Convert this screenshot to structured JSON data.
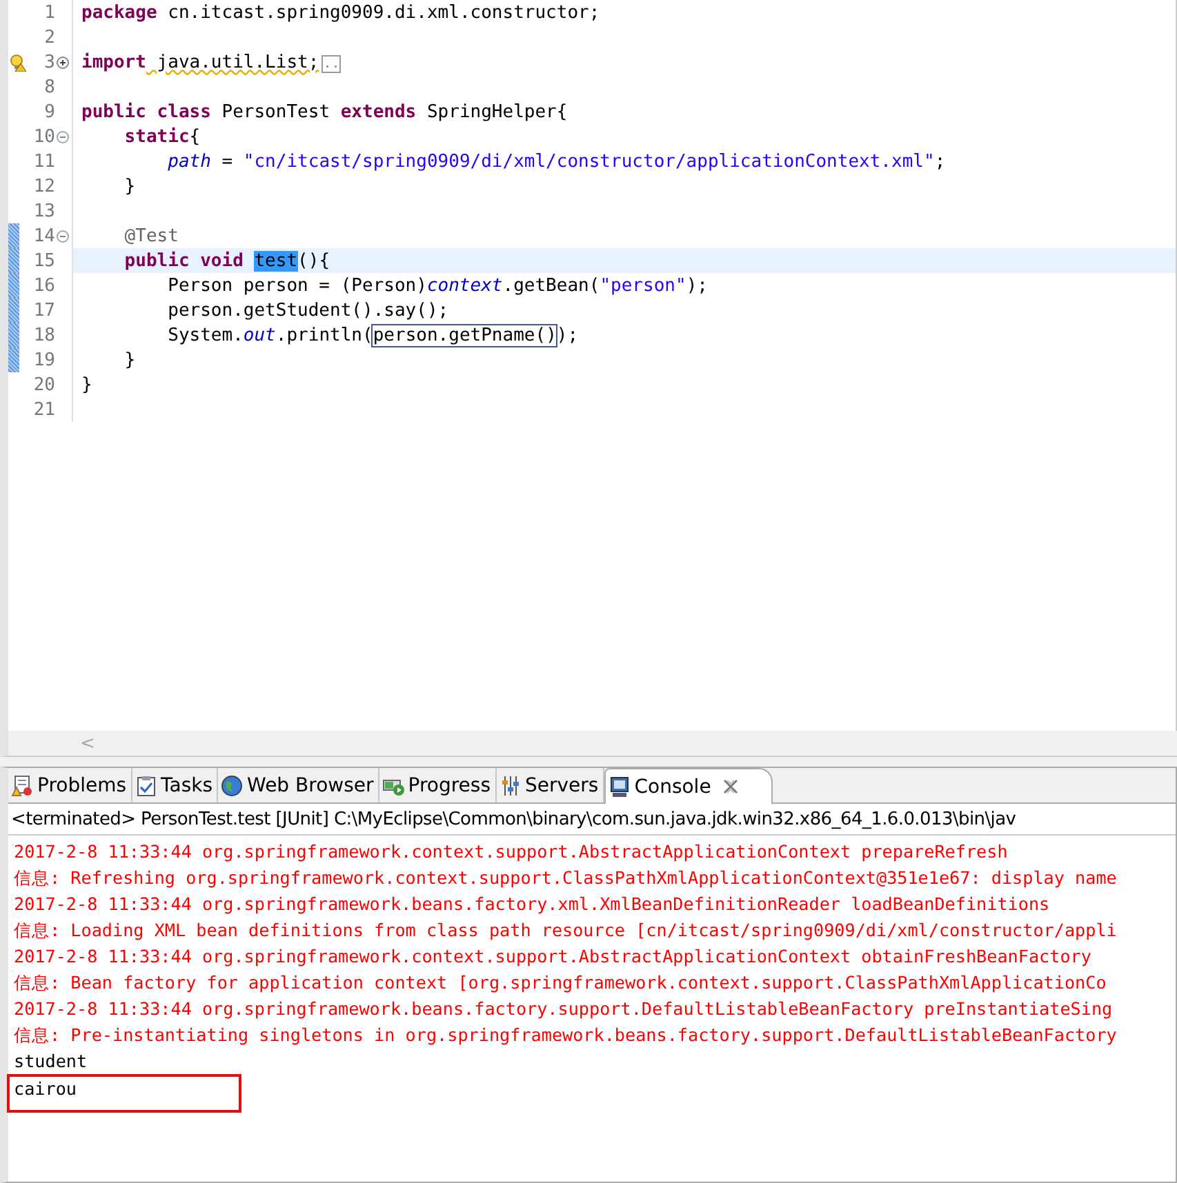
{
  "editor": {
    "lines": [
      {
        "number": "1",
        "warning": false,
        "changed": false,
        "current": false,
        "tokens": [
          {
            "kind": "keyword",
            "text": "package"
          },
          {
            "kind": "plain",
            "text": " cn.itcast.spring0909.di.xml.constructor;"
          }
        ]
      },
      {
        "number": "2",
        "warning": false,
        "changed": false,
        "current": false
      },
      {
        "number": "3",
        "fold_marker": {
          "expanded": false
        },
        "warning": true,
        "changed": false,
        "current": false,
        "tokens": [
          {
            "kind": "keyword",
            "text": "import"
          },
          {
            "kind": "squiggle",
            "text": " java.util.List;"
          },
          {
            "kind": "folded",
            "text": ".."
          }
        ]
      },
      {
        "number": "8",
        "warning": false,
        "changed": false,
        "current": false
      },
      {
        "number": "9",
        "warning": false,
        "changed": false,
        "current": false,
        "tokens": [
          {
            "kind": "keyword",
            "text": "public class"
          },
          {
            "kind": "plain",
            "text": " PersonTest "
          },
          {
            "kind": "keyword",
            "text": "extends"
          },
          {
            "kind": "plain",
            "text": " SpringHelper{"
          }
        ]
      },
      {
        "number": "10",
        "fold_marker": {
          "expanded": true
        },
        "warning": false,
        "changed": false,
        "current": false,
        "tokens": [
          {
            "kind": "keyword",
            "text": "    static"
          },
          {
            "kind": "plain",
            "text": "{"
          }
        ]
      },
      {
        "number": "11",
        "warning": false,
        "changed": false,
        "current": false,
        "tokens": [
          {
            "kind": "field",
            "text": "        path"
          },
          {
            "kind": "plain",
            "text": " = "
          },
          {
            "kind": "string",
            "text": "\"cn/itcast/spring0909/di/xml/constructor/applicationContext.xml\""
          },
          {
            "kind": "plain",
            "text": ";"
          }
        ]
      },
      {
        "number": "12",
        "warning": false,
        "changed": false,
        "current": false,
        "tokens": [
          {
            "kind": "plain",
            "text": "    }"
          }
        ]
      },
      {
        "number": "13",
        "warning": false,
        "changed": false,
        "current": false
      },
      {
        "number": "14",
        "fold_marker": {
          "expanded": true
        },
        "warning": false,
        "changed": true,
        "current": false,
        "tokens": [
          {
            "kind": "annotation",
            "text": "    @Test"
          }
        ]
      },
      {
        "number": "15",
        "warning": false,
        "changed": true,
        "current": true,
        "tokens": [
          {
            "kind": "keyword",
            "text": "    public void "
          },
          {
            "kind": "selected",
            "text": "test"
          },
          {
            "kind": "plain",
            "text": "(){"
          }
        ]
      },
      {
        "number": "16",
        "warning": false,
        "changed": true,
        "current": false,
        "tokens": [
          {
            "kind": "plain",
            "text": "        Person person = (Person)"
          },
          {
            "kind": "field",
            "text": "context"
          },
          {
            "kind": "plain",
            "text": ".getBean("
          },
          {
            "kind": "string",
            "text": "\"person\""
          },
          {
            "kind": "plain",
            "text": ");"
          }
        ]
      },
      {
        "number": "17",
        "warning": false,
        "changed": true,
        "current": false,
        "tokens": [
          {
            "kind": "plain",
            "text": "        person.getStudent().say();"
          }
        ]
      },
      {
        "number": "18",
        "warning": false,
        "changed": true,
        "current": false,
        "tokens": [
          {
            "kind": "plain",
            "text": "        System."
          },
          {
            "kind": "field",
            "text": "out"
          },
          {
            "kind": "plain",
            "text": ".println("
          },
          {
            "kind": "boxed",
            "text": "person.getPname()"
          },
          {
            "kind": "plain",
            "text": ");"
          }
        ]
      },
      {
        "number": "19",
        "warning": false,
        "changed": true,
        "current": false,
        "tokens": [
          {
            "kind": "plain",
            "text": "    }"
          }
        ]
      },
      {
        "number": "20",
        "warning": false,
        "changed": false,
        "current": false,
        "tokens": [
          {
            "kind": "plain",
            "text": "}"
          }
        ]
      },
      {
        "number": "21",
        "warning": false,
        "changed": false,
        "current": false
      }
    ],
    "scroll_arrow": "<"
  },
  "tabs": [
    {
      "label": "Problems",
      "selected": false
    },
    {
      "label": "Tasks",
      "selected": false
    },
    {
      "label": "Web Browser",
      "selected": false
    },
    {
      "label": "Progress",
      "selected": false
    },
    {
      "label": "Servers",
      "selected": false
    },
    {
      "label": "Console",
      "selected": true
    }
  ],
  "console": {
    "header": "<terminated> PersonTest.test [JUnit] C:\\MyEclipse\\Common\\binary\\com.sun.java.jdk.win32.x86_64_1.6.0.013\\bin\\jav",
    "lines": [
      {
        "kind": "error",
        "text": "2017-2-8 11:33:44 org.springframework.context.support.AbstractApplicationContext prepareRefresh",
        "highlighted": false
      },
      {
        "kind": "error",
        "text": "信息: Refreshing org.springframework.context.support.ClassPathXmlApplicationContext@351e1e67: display name",
        "highlighted": false
      },
      {
        "kind": "error",
        "text": "2017-2-8 11:33:44 org.springframework.beans.factory.xml.XmlBeanDefinitionReader loadBeanDefinitions",
        "highlighted": false
      },
      {
        "kind": "error",
        "text": "信息: Loading XML bean definitions from class path resource [cn/itcast/spring0909/di/xml/constructor/appli",
        "highlighted": false
      },
      {
        "kind": "error",
        "text": "2017-2-8 11:33:44 org.springframework.context.support.AbstractApplicationContext obtainFreshBeanFactory",
        "highlighted": false
      },
      {
        "kind": "error",
        "text": "信息: Bean factory for application context [org.springframework.context.support.ClassPathXmlApplicationCo",
        "highlighted": false
      },
      {
        "kind": "error",
        "text": "2017-2-8 11:33:44 org.springframework.beans.factory.support.DefaultListableBeanFactory preInstantiateSing",
        "highlighted": false
      },
      {
        "kind": "error",
        "text": "信息: Pre-instantiating singletons in org.springframework.beans.factory.support.DefaultListableBeanFactory",
        "highlighted": false
      },
      {
        "kind": "output",
        "text": "student",
        "highlighted": false
      },
      {
        "kind": "output",
        "text": "cairou",
        "highlighted": true
      }
    ]
  }
}
